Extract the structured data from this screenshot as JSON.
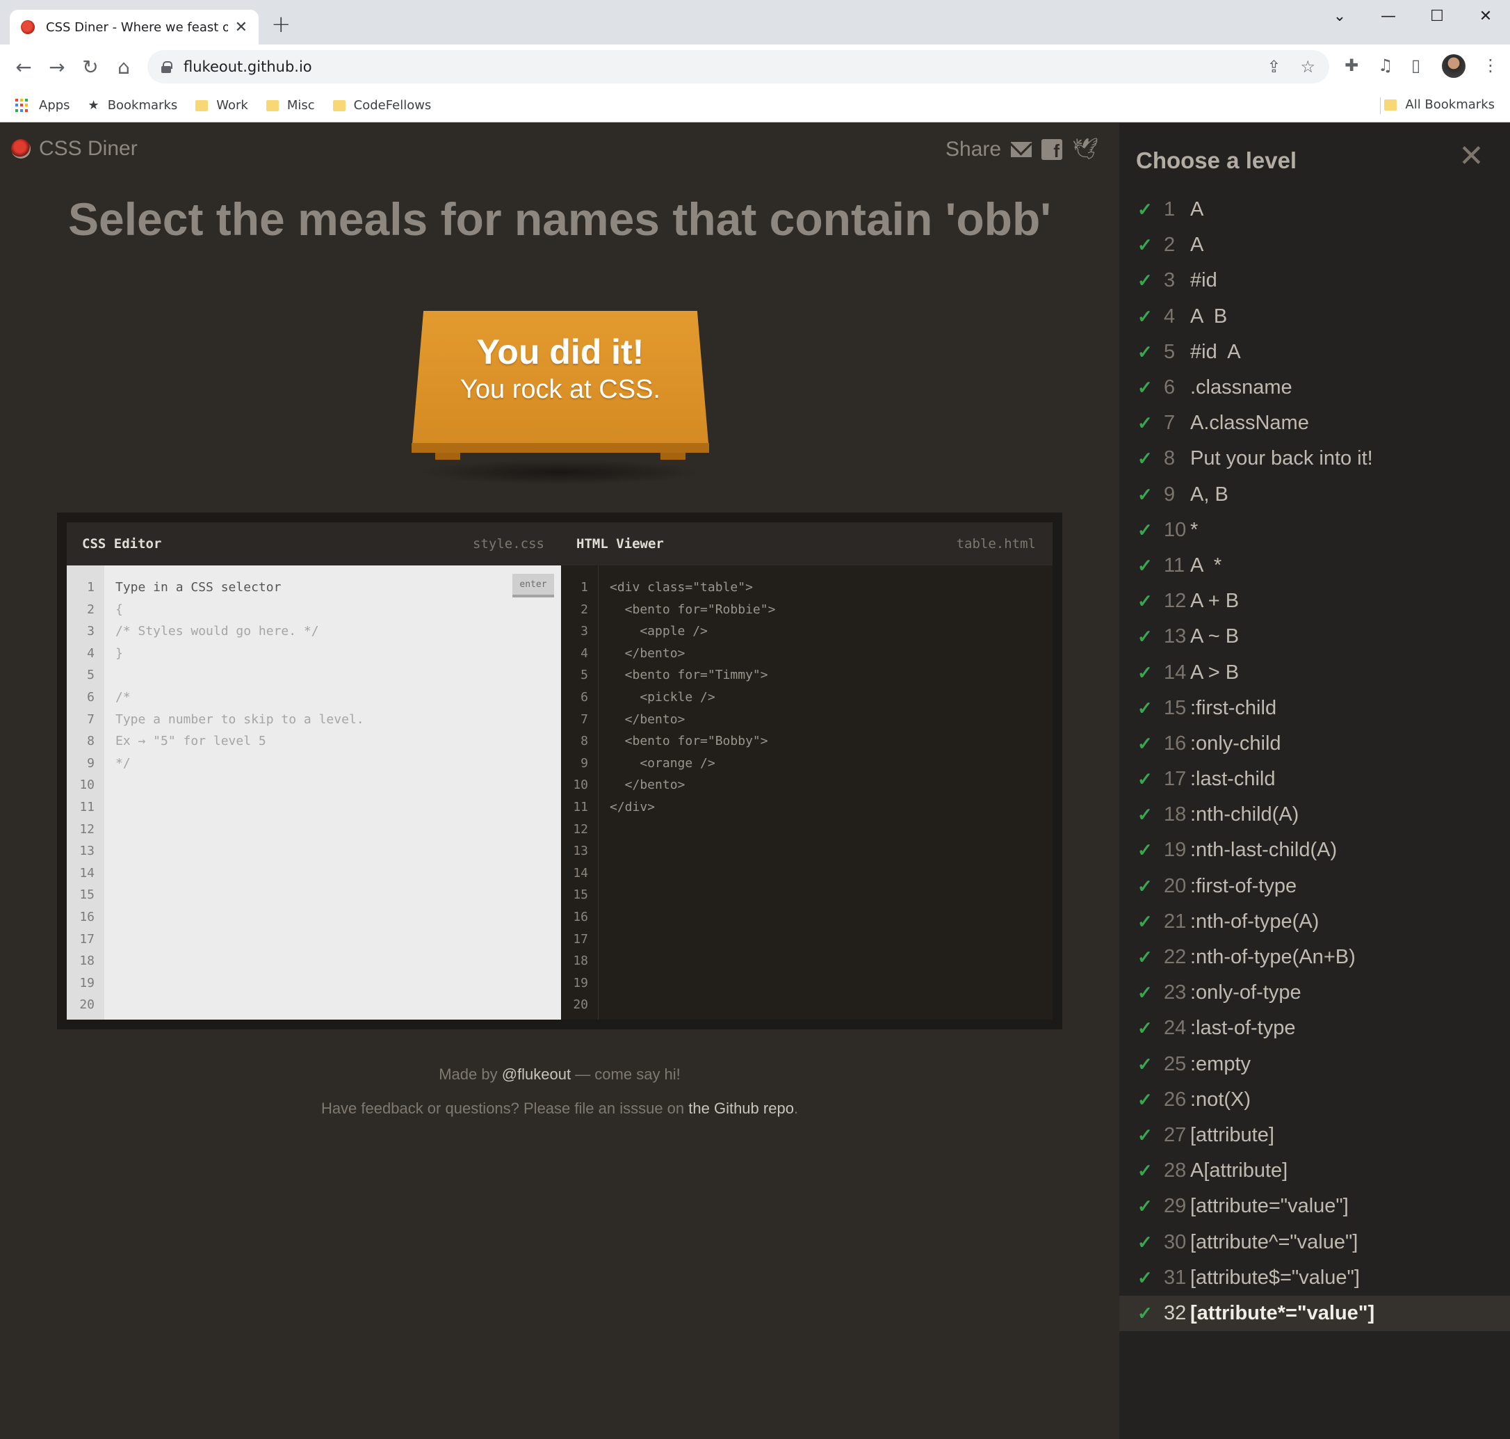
{
  "browser": {
    "tab_title": "CSS Diner - Where we feast on C",
    "tab_close": "✕",
    "new_tab": "+",
    "url": "flukeout.github.io",
    "window_controls": [
      "⌄",
      "—",
      "☐",
      "✕"
    ],
    "bookmarks": [
      {
        "label": "Apps",
        "icon": "apps-icon"
      },
      {
        "label": "Bookmarks",
        "icon": "star-icon"
      },
      {
        "label": "Work",
        "icon": "folder-icon"
      },
      {
        "label": "Misc",
        "icon": "folder-icon"
      },
      {
        "label": "CodeFellows",
        "icon": "folder-icon"
      }
    ],
    "all_bookmarks": "All Bookmarks",
    "folder_color": "#f8d775"
  },
  "header": {
    "logo": "CSS Diner",
    "share_label": "Share"
  },
  "order": "Select the meals for names that contain 'obb'",
  "win": {
    "line1": "You did it!",
    "line2": "You rock at CSS."
  },
  "css_editor": {
    "title": "CSS Editor",
    "file": "style.css",
    "enter_label": "enter",
    "line_numbers": "1\n2\n3\n4\n5\n6\n7\n8\n9\n10\n11\n12\n13\n14\n15\n16\n17\n18\n19\n20",
    "input_placeholder": "Type in a CSS selector",
    "code": "{\n/* Styles would go here. */\n}\n\n/*\nType a number to skip to a level.\nEx → \"5\" for level 5\n*/"
  },
  "html_viewer": {
    "title": "HTML Viewer",
    "file": "table.html",
    "line_numbers": "1\n2\n3\n4\n5\n6\n7\n8\n9\n10\n11\n12\n13\n14\n15\n16\n17\n18\n19\n20",
    "code": "<div class=\"table\">\n  <bento for=\"Robbie\">\n    <apple />\n  </bento>\n  <bento for=\"Timmy\">\n    <pickle />\n  </bento>\n  <bento for=\"Bobby\">\n    <orange />\n  </bento>\n</div>"
  },
  "footer": {
    "made_by_prefix": "Made by ",
    "made_by_link": "@flukeout",
    "made_by_suffix": " — come say hi!",
    "feedback_prefix": "Have feedback or questions? Please file an isssue on ",
    "feedback_link": "the Github repo",
    "feedback_suffix": "."
  },
  "sidebar": {
    "title": "Choose a level",
    "close": "✕",
    "check": "✓",
    "check_color": "#3aa652",
    "current_level": 32,
    "levels": [
      {
        "num": "1",
        "name": "A"
      },
      {
        "num": "2",
        "name": "A"
      },
      {
        "num": "3",
        "name": "#id"
      },
      {
        "num": "4",
        "name": "A  B"
      },
      {
        "num": "5",
        "name": "#id  A"
      },
      {
        "num": "6",
        "name": ".classname"
      },
      {
        "num": "7",
        "name": "A.className"
      },
      {
        "num": "8",
        "name": "Put your back into it!"
      },
      {
        "num": "9",
        "name": "A, B"
      },
      {
        "num": "10",
        "name": "*"
      },
      {
        "num": "11",
        "name": "A  *"
      },
      {
        "num": "12",
        "name": "A + B"
      },
      {
        "num": "13",
        "name": "A ~ B"
      },
      {
        "num": "14",
        "name": "A > B"
      },
      {
        "num": "15",
        "name": ":first-child"
      },
      {
        "num": "16",
        "name": ":only-child"
      },
      {
        "num": "17",
        "name": ":last-child"
      },
      {
        "num": "18",
        "name": ":nth-child(A)"
      },
      {
        "num": "19",
        "name": ":nth-last-child(A)"
      },
      {
        "num": "20",
        "name": ":first-of-type"
      },
      {
        "num": "21",
        "name": ":nth-of-type(A)"
      },
      {
        "num": "22",
        "name": ":nth-of-type(An+B)"
      },
      {
        "num": "23",
        "name": ":only-of-type"
      },
      {
        "num": "24",
        "name": ":last-of-type"
      },
      {
        "num": "25",
        "name": ":empty"
      },
      {
        "num": "26",
        "name": ":not(X)"
      },
      {
        "num": "27",
        "name": "[attribute]"
      },
      {
        "num": "28",
        "name": "A[attribute]"
      },
      {
        "num": "29",
        "name": "[attribute=\"value\"]"
      },
      {
        "num": "30",
        "name": "[attribute^=\"value\"]"
      },
      {
        "num": "31",
        "name": "[attribute$=\"value\"]"
      },
      {
        "num": "32",
        "name": "[attribute*=\"value\"]"
      }
    ]
  }
}
